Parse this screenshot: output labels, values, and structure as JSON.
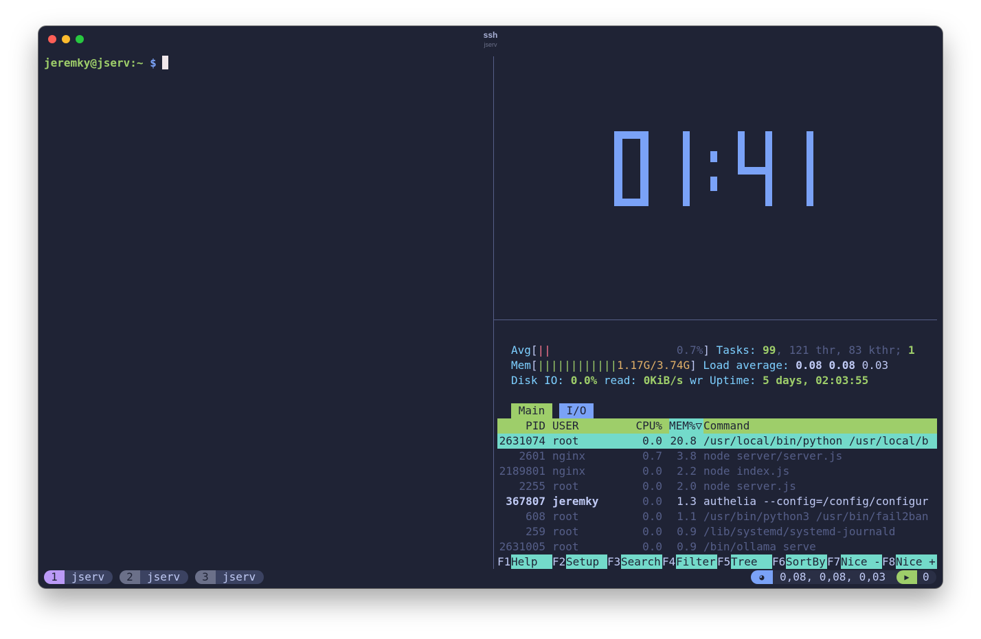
{
  "window": {
    "title": "ssh",
    "subtitle": "jserv"
  },
  "left_pane": {
    "prompt_user_host": "jeremky@jserv",
    "prompt_path": ":~",
    "prompt_symbol": "$"
  },
  "clock": {
    "time": "01:41",
    "color": "#7aa2f7"
  },
  "htop": {
    "cpu_label": "Avg",
    "cpu_bar": "||",
    "cpu_percent": "0.7%",
    "mem_label": "Mem",
    "mem_bar": "||||||||||||",
    "mem_value": "1.17G/3.74G",
    "disk_label": "Disk IO:",
    "disk_percent": "0.0%",
    "disk_read_label": "read:",
    "disk_read": "0KiB/s",
    "disk_wr_label": "wr",
    "tasks_label": "Tasks:",
    "tasks_count": "99",
    "tasks_thr": ", 121 thr, 83 kthr;",
    "tasks_running": "1",
    "load_label": "Load average:",
    "load_1": "0.08",
    "load_5": "0.08",
    "load_15": "0.03",
    "uptime_label": "Uptime:",
    "uptime": "5 days, 02:03:55",
    "tabs": [
      "Main",
      "I/O"
    ],
    "columns": {
      "pid": "PID",
      "user": "USER",
      "cpu": "CPU%",
      "mem": "MEM%▽",
      "command": "Command"
    },
    "processes": [
      {
        "pid": "2631074",
        "user": "root",
        "cpu": "0.0",
        "mem": "20.8",
        "command": "/usr/local/bin/python /usr/local/b"
      },
      {
        "pid": "2601",
        "user": "nginx",
        "cpu": "0.7",
        "mem": "3.8",
        "command": "node server/server.js"
      },
      {
        "pid": "2189801",
        "user": "nginx",
        "cpu": "0.0",
        "mem": "2.2",
        "command": "node index.js"
      },
      {
        "pid": "2255",
        "user": "root",
        "cpu": "0.0",
        "mem": "2.0",
        "command": "node server.js"
      },
      {
        "pid": "367807",
        "user": "jeremky",
        "cpu": "0.0",
        "mem": "1.3",
        "command": "authelia --config=/config/configur"
      },
      {
        "pid": "608",
        "user": "root",
        "cpu": "0.0",
        "mem": "1.1",
        "command": "/usr/bin/python3 /usr/bin/fail2ban"
      },
      {
        "pid": "259",
        "user": "root",
        "cpu": "0.0",
        "mem": "0.9",
        "command": "/lib/systemd/systemd-journald"
      },
      {
        "pid": "2631005",
        "user": "root",
        "cpu": "0.0",
        "mem": "0.9",
        "command": "/bin/ollama serve"
      }
    ],
    "function_keys": [
      {
        "key": "F1",
        "label": "Help  "
      },
      {
        "key": "F2",
        "label": "Setup "
      },
      {
        "key": "F3",
        "label": "Search"
      },
      {
        "key": "F4",
        "label": "Filter"
      },
      {
        "key": "F5",
        "label": "Tree  "
      },
      {
        "key": "F6",
        "label": "SortBy"
      },
      {
        "key": "F7",
        "label": "Nice -"
      },
      {
        "key": "F8",
        "label": "Nice +"
      }
    ]
  },
  "statusbar": {
    "windows": [
      {
        "index": "1",
        "name": "jserv"
      },
      {
        "index": "2",
        "name": "jserv"
      },
      {
        "index": "3",
        "name": "jserv"
      }
    ],
    "load_icon": "◕",
    "load_text": "0,08, 0,08, 0,03",
    "session_icon": "▶",
    "session_count": "0"
  }
}
